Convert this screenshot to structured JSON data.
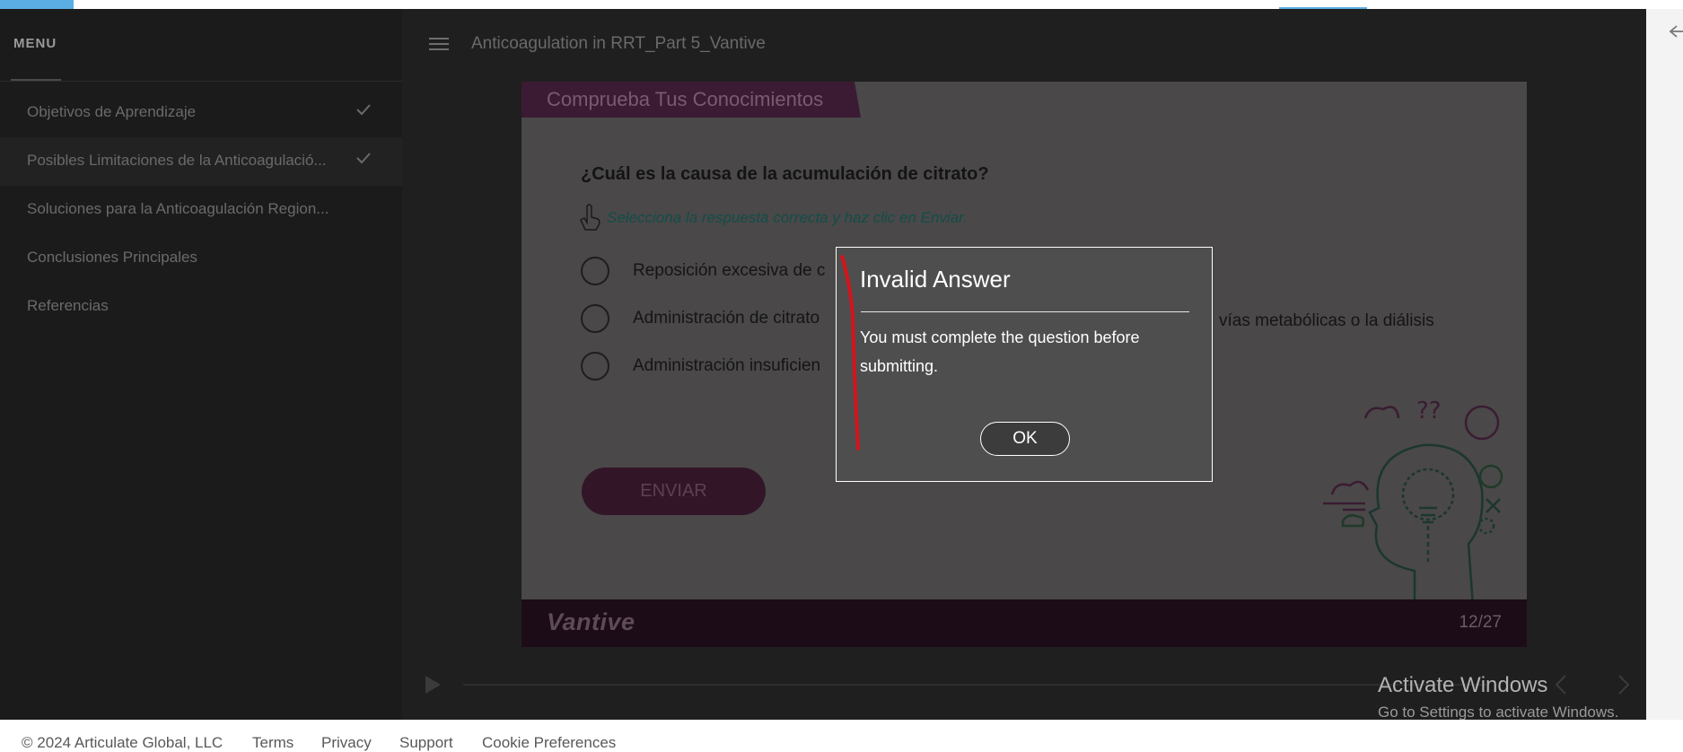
{
  "sidebar": {
    "menu_label": "MENU",
    "items": [
      {
        "label": "Objetivos de Aprendizaje",
        "completed": true
      },
      {
        "label": "Posibles Limitaciones de la Anticoagulació...",
        "completed": true
      },
      {
        "label": "Soluciones para la Anticoagulación Region...",
        "completed": false
      },
      {
        "label": "Conclusiones Principales",
        "completed": false
      },
      {
        "label": "Referencias",
        "completed": false
      }
    ]
  },
  "header": {
    "course_title": "Anticoagulation in RRT_Part 5_Vantive"
  },
  "slide": {
    "section_title": "Comprueba Tus Conocimientos",
    "question": "¿Cuál es la causa de la acumulación de citrato?",
    "instruction": "Selecciona la respuesta correcta y haz clic en Enviar.",
    "options": [
      {
        "text": "Reposición excesiva de c"
      },
      {
        "text": "Administración de citrato",
        "tail": "vías metabólicas o la diálisis"
      },
      {
        "text": "Administración insuficien"
      }
    ],
    "submit_label": "ENVIAR",
    "brand": "Vantive",
    "counter": "12/27"
  },
  "dialog": {
    "title": "Invalid Answer",
    "message": "You must complete the question before submitting.",
    "ok_label": "OK"
  },
  "watermark": {
    "title": "Activate Windows",
    "subtitle": "Go to Settings to activate Windows."
  },
  "footer": {
    "copyright": "© 2024 Articulate Global, LLC",
    "links": [
      "Terms",
      "Privacy",
      "Support",
      "Cookie Preferences"
    ]
  },
  "colors": {
    "accent": "#5aaee3",
    "slide_header": "#3b1b34",
    "dialog_bg": "#4e4e4e",
    "annotation": "#d4141c"
  }
}
